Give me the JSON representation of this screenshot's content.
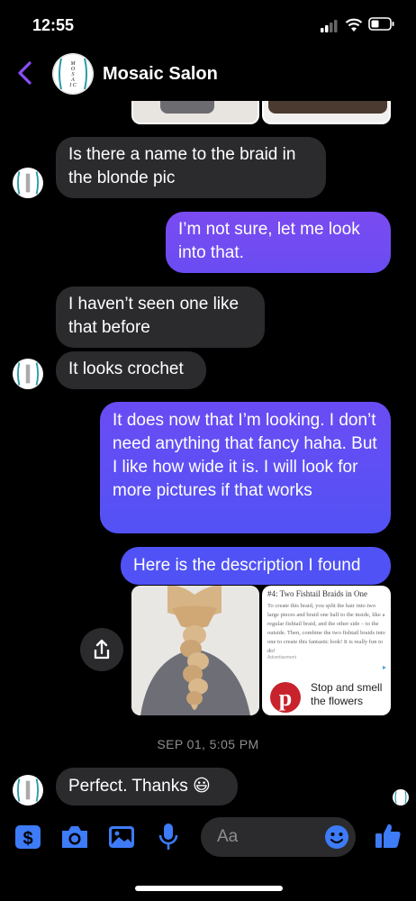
{
  "status_bar": {
    "time": "12:55"
  },
  "header": {
    "contact_name": "Mosaic Salon",
    "avatar_text": "MOSAIC"
  },
  "messages": {
    "m1": "Is there a name to the braid in the blonde pic",
    "m2": "I’m not sure, let me look into that.",
    "m3": "I haven’t seen one like that before",
    "m4": "It looks crochet",
    "m5": "It does now that I’m looking. I don’t need anything that fancy haha. But I like how wide it is. I will look for more pictures if that works",
    "m6": "Here is the description I found",
    "m7": "Perfect. Thanks 😃"
  },
  "article": {
    "title": "#4: Two Fishtail Braids in One",
    "body": "To create this braid, you split the hair into two large pieces and braid one half to the inside, like a regular fishtail braid, and the other side – to the outside. Then, combine the two fishtail braids into one to create this fantastic look! It is really fun to do!",
    "ad_label": "Advertisement",
    "ad_text": "Stop and smell the flowers"
  },
  "timestamp": "SEP 01, 5:05 PM",
  "composer": {
    "placeholder": "Aa"
  },
  "colors": {
    "accent": "#5b4ff5",
    "sent_top": "#7a4bf0",
    "sent_bottom": "#4f53f6",
    "received": "#2b2b2e",
    "icon_blue": "#3d7bf7"
  }
}
